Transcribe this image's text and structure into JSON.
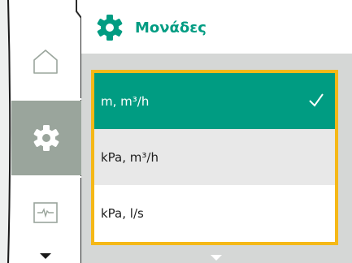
{
  "header": {
    "title": "Μονάδες",
    "icon": "gear-icon",
    "accent_color": "#009c82"
  },
  "sidebar": {
    "items": [
      {
        "name": "home",
        "icon": "home-icon",
        "selected": false
      },
      {
        "name": "settings",
        "icon": "gear-icon",
        "selected": true
      },
      {
        "name": "monitor",
        "icon": "pulse-monitor-icon",
        "selected": false
      }
    ],
    "more_icon": "chevron-down-icon"
  },
  "list": {
    "highlight_color": "#f5b817",
    "items": [
      {
        "label": "m, m³/h",
        "selected": true,
        "checked": true
      },
      {
        "label": "kPa, m³/h",
        "selected": false,
        "checked": false
      },
      {
        "label": "kPa, l/s",
        "selected": false,
        "checked": false
      }
    ],
    "more_icon": "chevron-down-icon"
  }
}
